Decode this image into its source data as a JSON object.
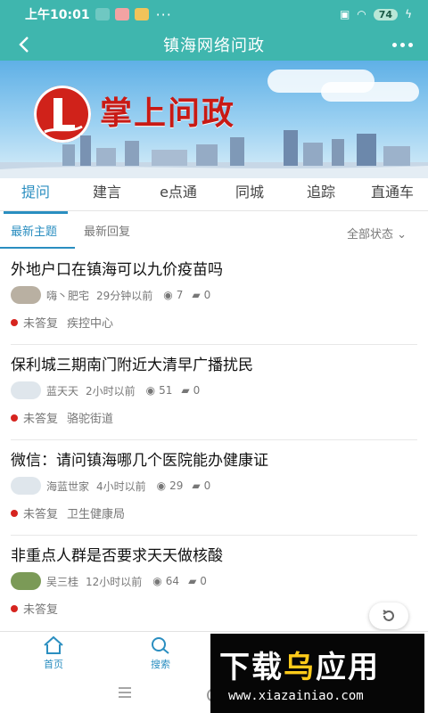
{
  "status_bar": {
    "time": "上午10:01",
    "dots": "···",
    "battery": "74"
  },
  "header": {
    "title": "镇海网络问政"
  },
  "banner": {
    "brand": "掌上问政"
  },
  "tabs": [
    "提问",
    "建言",
    "e点通",
    "同城",
    "追踪",
    "直通车"
  ],
  "active_tab": "提问",
  "subtabs": {
    "latest_topic": "最新主题",
    "latest_reply": "最新回复",
    "filter": "全部状态"
  },
  "posts": [
    {
      "title": "外地户口在镇海可以九价疫苗吗",
      "user": "嗨丶肥宅",
      "time": "29分钟以前",
      "views": "7",
      "comments": "0",
      "status": "未答复",
      "dept": "疾控中心"
    },
    {
      "title": "保利城三期南门附近大清早广播扰民",
      "user": "蓝天天",
      "time": "2小时以前",
      "views": "51",
      "comments": "0",
      "status": "未答复",
      "dept": "骆驼街道"
    },
    {
      "title": "微信：请问镇海哪几个医院能办健康证",
      "user": "海蓝世家",
      "time": "4小时以前",
      "views": "29",
      "comments": "0",
      "status": "未答复",
      "dept": "卫生健康局"
    },
    {
      "title": "非重点人群是否要求天天做核酸",
      "user": "吴三桂",
      "time": "12小时以前",
      "views": "64",
      "comments": "0",
      "status": "未答复",
      "dept": ""
    }
  ],
  "bottom_nav": {
    "home": "首页",
    "search": "搜索"
  },
  "watermark": {
    "text_a": "下载",
    "text_b": "乌",
    "text_c": "应用",
    "url": "www.xiazainiao.com"
  },
  "colors": {
    "primary": "#3fb6ae",
    "accent": "#2a8ec0",
    "unanswered": "#d6241f"
  }
}
